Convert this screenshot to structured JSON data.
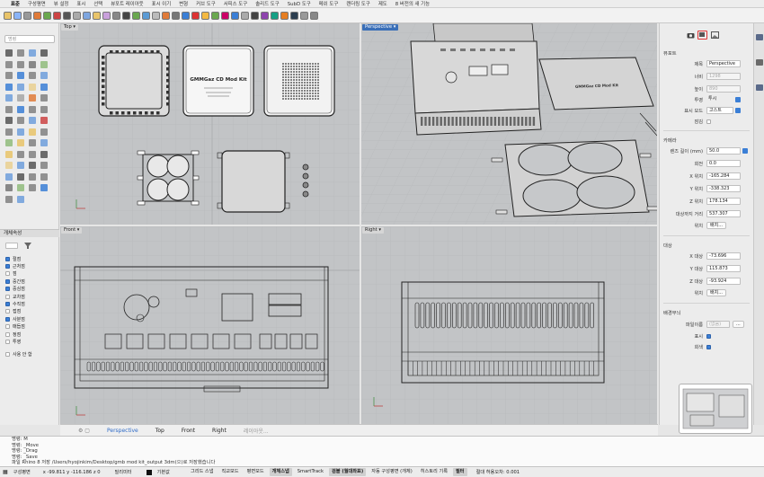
{
  "menu_tabs": [
    "표준",
    "구성평면",
    "뷰 설정",
    "표시",
    "선택",
    "뷰포트 레이아웃",
    "표시 이기",
    "변형",
    "커브 도구",
    "서피스 도구",
    "솔리드 도구",
    "SubD 도구",
    "메쉬 도구",
    "렌더링 도구",
    "제도",
    "8 버전의 새 기능"
  ],
  "command_box": {
    "placeholder": "명령"
  },
  "layers_panel": {
    "title": "개체속성",
    "items": [
      {
        "label": "절점",
        "checked": true
      },
      {
        "label": "근처점",
        "checked": true
      },
      {
        "label": "점",
        "checked": false
      },
      {
        "label": "중간점",
        "checked": true
      },
      {
        "label": "중심점",
        "checked": true
      },
      {
        "label": "교차점",
        "checked": false
      },
      {
        "label": "수직점",
        "checked": true
      },
      {
        "label": "접점",
        "checked": false
      },
      {
        "label": "사분점",
        "checked": true
      },
      {
        "label": "매듭점",
        "checked": false
      },
      {
        "label": "정점",
        "checked": false
      },
      {
        "label": "투영",
        "checked": false
      },
      {
        "label": "사용 안 함",
        "checked": false
      }
    ]
  },
  "viewports": {
    "top": {
      "label": "Top"
    },
    "perspective": {
      "label": "Perspective"
    },
    "front": {
      "label": "Front"
    },
    "right": {
      "label": "Right"
    }
  },
  "viewport_tabs": [
    "Perspective",
    "Top",
    "Front",
    "Right",
    "레이아웃..."
  ],
  "active_viewport_tab": "Perspective",
  "model_labels": {
    "board_text": "GMMGaz CD Mod Kit"
  },
  "history": [
    "명령: M",
    "명령: _Move",
    "명령: _Drag",
    "명령: _Save",
    "파일 Rhino 8 저장 /Users/hyojinkim/Desktop/gmb mod kit_output 3dm(으)로 저장했습니다"
  ],
  "status_bar": {
    "plane": "구성평면",
    "coords": "x -99.811   y -116.186   z 0",
    "units": "밀리미터",
    "layer": "기본값",
    "toggles": [
      {
        "label": "그리드 스냅",
        "on": false
      },
      {
        "label": "직교모드",
        "on": false
      },
      {
        "label": "평면모드",
        "on": false
      },
      {
        "label": "개체스냅",
        "on": true
      },
      {
        "label": "SmartTrack",
        "on": false
      },
      {
        "label": "검볼 (월대좌표)",
        "on": true
      },
      {
        "label": "자동 구성평면 (개체)",
        "on": false
      },
      {
        "label": "히스토리 기록",
        "on": false
      },
      {
        "label": "필터",
        "on": true
      }
    ],
    "tolerance": "절대 허용오차: 0.001"
  },
  "properties": {
    "viewport_section": "뷰포트",
    "title_label": "제목",
    "title_value": "Perspective",
    "width_label": "너비",
    "width_value": "1298",
    "height_label": "높이",
    "height_value": "890",
    "projection_label": "투영",
    "projection_value": "투시",
    "display_label": "표시 모드",
    "display_value": "고스트",
    "lock_label": "잠김",
    "camera_section": "카메라",
    "lens_label": "렌즈 길이 (mm)",
    "lens_value": "50.0",
    "rotation_label": "회전",
    "rotation_value": "0.0",
    "xpos_label": "X 위치",
    "xpos_value": "-165.284",
    "ypos_label": "Y 위치",
    "ypos_value": "-338.323",
    "zpos_label": "Z 위치",
    "zpos_value": "178.134",
    "distance_label": "대상까지 거리",
    "distance_value": "537.307",
    "location_label": "위치",
    "location_button": "배치...",
    "target_section": "대상",
    "xt_label": "X 대상",
    "xt_value": "-73.696",
    "yt_label": "Y 대상",
    "yt_value": "115.873",
    "zt_label": "Z 대상",
    "zt_value": "-93.924",
    "target_location_button": "배치...",
    "wallpaper_section": "배경무늬",
    "filename_label": "파일이름",
    "filename_value": "(없음)",
    "filename_button": "...",
    "show_label": "표시",
    "gray_label": "회색"
  },
  "colors": {
    "accent": "#3b7fd6",
    "viewport_bg": "#c2c4c6",
    "active_label": "#3a6fb8"
  }
}
